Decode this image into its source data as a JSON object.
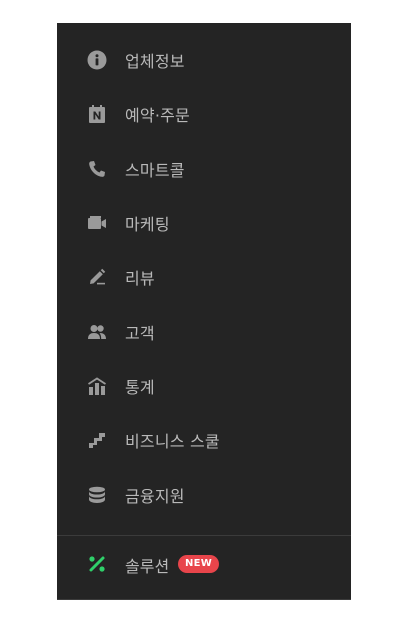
{
  "menu": {
    "items": [
      {
        "label": "업체정보",
        "icon": "info-icon"
      },
      {
        "label": "예약·주문",
        "icon": "naver-calendar-icon"
      },
      {
        "label": "스마트콜",
        "icon": "phone-icon"
      },
      {
        "label": "마케팅",
        "icon": "camera-icon"
      },
      {
        "label": "리뷰",
        "icon": "pencil-icon"
      },
      {
        "label": "고객",
        "icon": "users-icon"
      },
      {
        "label": "통계",
        "icon": "stats-icon"
      },
      {
        "label": "비즈니스 스쿨",
        "icon": "stairs-icon"
      },
      {
        "label": "금융지원",
        "icon": "coins-icon"
      }
    ]
  },
  "solution": {
    "label": "솔루션",
    "badge": "NEW",
    "icon": "solution-icon"
  },
  "colors": {
    "panel_bg": "#242424",
    "text": "#b9b9b9",
    "icon": "#9a9a9a",
    "badge_bg": "#e8454b",
    "accent_green": "#2fd06a"
  }
}
